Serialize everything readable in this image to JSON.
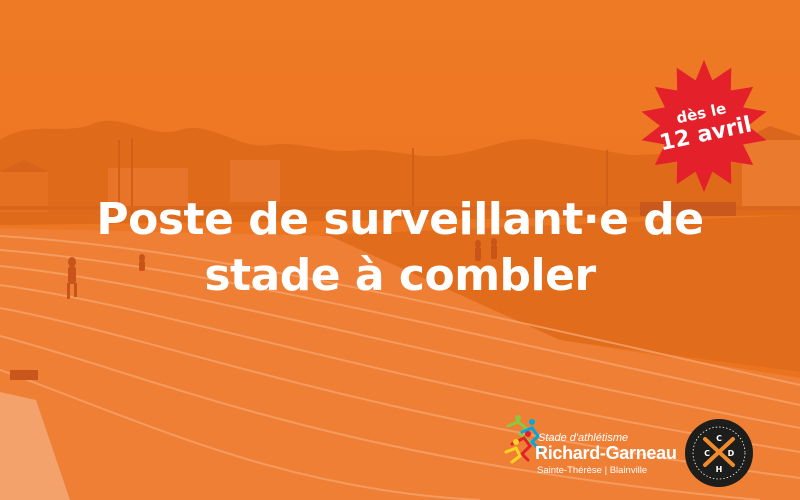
{
  "headline": {
    "line1": "Poste de surveillant·e de",
    "line2": "stade à combler"
  },
  "badge": {
    "line1": "dès le",
    "line2": "12 avril",
    "color": "#e4202b"
  },
  "logo": {
    "line1": "Stade d'athlétisme",
    "line2": "Richard-Garneau",
    "line3": "Sainte-Thérèse | Blainville"
  },
  "seal": {
    "letters": "CCHD"
  },
  "colors": {
    "overlay": "#e8711f",
    "text": "#ffffff"
  }
}
